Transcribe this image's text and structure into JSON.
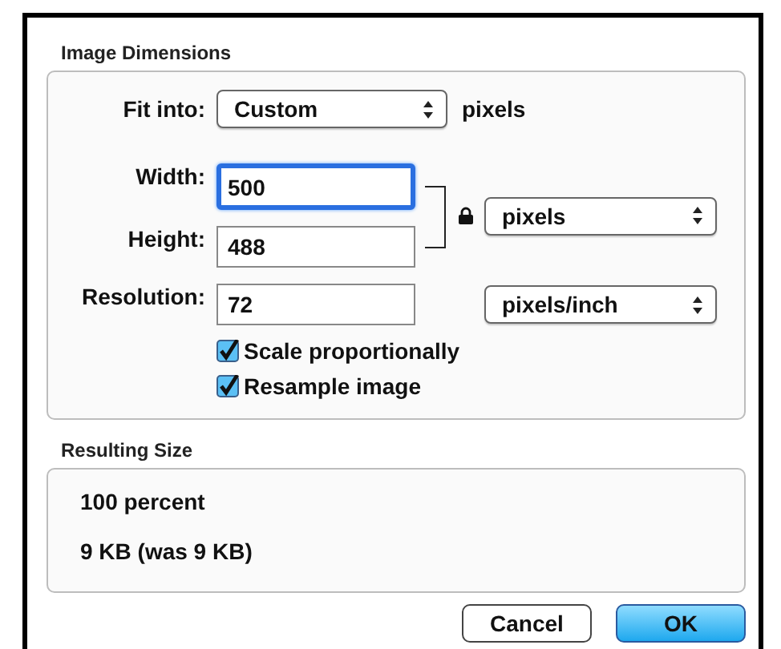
{
  "image_dimensions": {
    "title": "Image Dimensions",
    "fit_into": {
      "label": "Fit into:",
      "value": "Custom",
      "unit": "pixels"
    },
    "width": {
      "label": "Width:",
      "value": "500",
      "focused": true
    },
    "height": {
      "label": "Height:",
      "value": "488",
      "focused": false
    },
    "size_unit": "pixels",
    "resolution": {
      "label": "Resolution:",
      "value": "72",
      "focused": false
    },
    "resolution_unit": "pixels/inch",
    "checkboxes": [
      {
        "label": "Scale proportionally",
        "checked": true
      },
      {
        "label": "Resample image",
        "checked": true
      }
    ]
  },
  "resulting_size": {
    "title": "Resulting Size",
    "lines": [
      "100 percent",
      "9 KB (was 9 KB)"
    ]
  },
  "buttons": [
    {
      "label": "Cancel",
      "default": false
    },
    {
      "label": "OK",
      "default": true
    }
  ]
}
